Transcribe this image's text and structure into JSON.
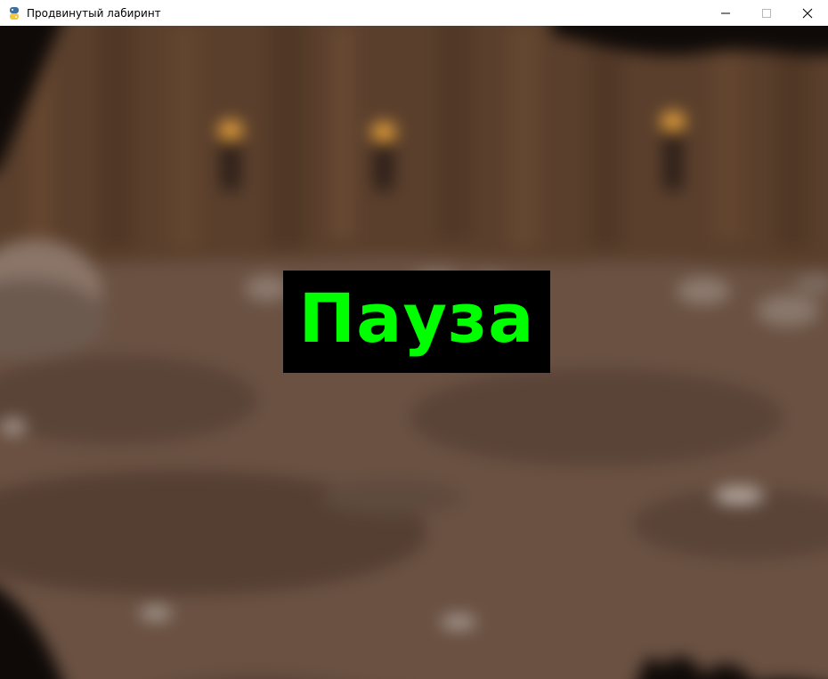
{
  "window": {
    "title": "Продвинутый лабиринт",
    "icon": "python-icon",
    "controls": [
      "minimize-icon",
      "maximize-icon",
      "close-icon"
    ]
  },
  "game": {
    "background": "blurred-cave-scene",
    "pause": {
      "label": "Пауза",
      "text_color": "#00ff00",
      "box_color": "#000000"
    }
  }
}
